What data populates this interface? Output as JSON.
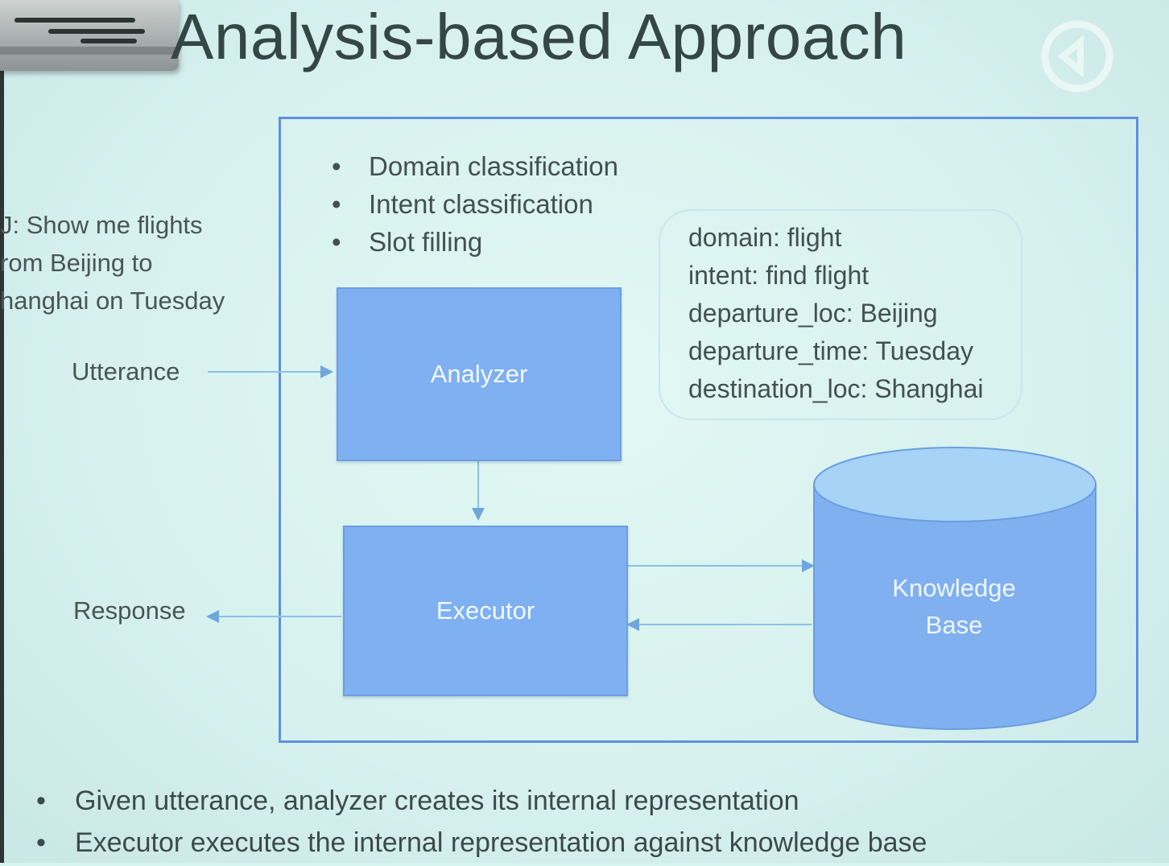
{
  "title": "Analysis-based Approach",
  "methods": [
    "Domain classification",
    "Intent classification",
    "Slot filling"
  ],
  "user_query": [
    "J: Show me flights",
    "rom Beijing to",
    "hanghai on Tuesday"
  ],
  "labels": {
    "utterance": "Utterance",
    "response": "Response"
  },
  "components": {
    "analyzer": "Analyzer",
    "executor": "Executor",
    "knowledge_base": [
      "Knowledge",
      "Base"
    ]
  },
  "representation": [
    "domain: flight",
    "intent: find flight",
    "departure_loc: Beijing",
    "departure_time: Tuesday",
    "destination_loc: Shanghai"
  ],
  "notes": [
    "Given utterance,  analyzer creates its internal representation",
    "Executor executes the internal representation against knowledge base"
  ],
  "colors": {
    "box_fill": "#7eb0f2",
    "cylinder_fill": "#80b0f0",
    "frame_border": "#5f90e0",
    "background": "#d7f3f0"
  }
}
